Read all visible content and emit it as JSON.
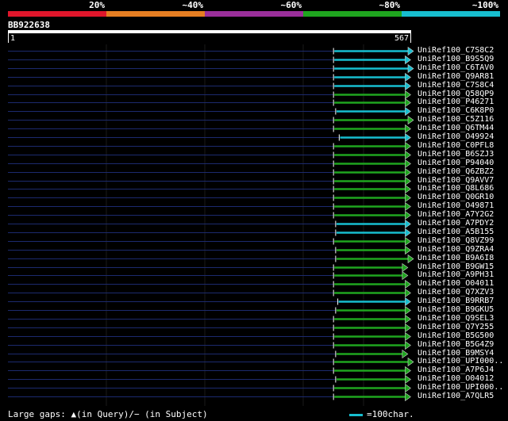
{
  "legend": {
    "items": [
      {
        "label": "20%",
        "color": "#e0162b"
      },
      {
        "label": "~40%",
        "color": "#e67e22"
      },
      {
        "label": "~60%",
        "color": "#9b2f9b"
      },
      {
        "label": "~80%",
        "color": "#1fa51f"
      },
      {
        "label": "~100%",
        "color": "#17becf"
      }
    ]
  },
  "query": {
    "name": "BB922638",
    "start": "1",
    "end": "567",
    "length": 567
  },
  "hits": [
    {
      "id": "UniRef100_C7S8C2",
      "color": "#17becf",
      "qstart": 458,
      "qend": 567,
      "arrow": true
    },
    {
      "id": "UniRef100_B9S5Q9",
      "color": "#17becf",
      "qstart": 458,
      "qend": 563,
      "arrow": true
    },
    {
      "id": "UniRef100_C6TAV0",
      "color": "#17becf",
      "qstart": 458,
      "qend": 567,
      "arrow": true
    },
    {
      "id": "UniRef100_Q9AR81",
      "color": "#17becf",
      "qstart": 458,
      "qend": 563,
      "arrow": true
    },
    {
      "id": "UniRef100_C7S8C4",
      "color": "#17becf",
      "qstart": 458,
      "qend": 563,
      "arrow": true
    },
    {
      "id": "UniRef100_Q58QP9",
      "color": "#1fa51f",
      "qstart": 458,
      "qend": 563,
      "arrow": true
    },
    {
      "id": "UniRef100_P46271",
      "color": "#1fa51f",
      "qstart": 458,
      "qend": 563,
      "arrow": true
    },
    {
      "id": "UniRef100_C6K8P0",
      "color": "#17becf",
      "qstart": 461,
      "qend": 563,
      "arrow": true
    },
    {
      "id": "UniRef100_C5Z116",
      "color": "#1fa51f",
      "qstart": 458,
      "qend": 567,
      "arrow": true
    },
    {
      "id": "UniRef100_Q6TM44",
      "color": "#1fa51f",
      "qstart": 458,
      "qend": 563,
      "arrow": true
    },
    {
      "id": "UniRef100_O49924",
      "color": "#17becf",
      "qstart": 466,
      "qend": 563,
      "arrow": true
    },
    {
      "id": "UniRef100_C0PFL8",
      "color": "#1fa51f",
      "qstart": 458,
      "qend": 563,
      "arrow": true
    },
    {
      "id": "UniRef100_B6SZJ3",
      "color": "#1fa51f",
      "qstart": 458,
      "qend": 563,
      "arrow": true
    },
    {
      "id": "UniRef100_P94040",
      "color": "#1fa51f",
      "qstart": 458,
      "qend": 563,
      "arrow": true
    },
    {
      "id": "UniRef100_Q6ZBZ2",
      "color": "#1fa51f",
      "qstart": 458,
      "qend": 563,
      "arrow": true
    },
    {
      "id": "UniRef100_Q9AVV7",
      "color": "#1fa51f",
      "qstart": 458,
      "qend": 563,
      "arrow": true
    },
    {
      "id": "UniRef100_Q8L686",
      "color": "#1fa51f",
      "qstart": 458,
      "qend": 563,
      "arrow": true
    },
    {
      "id": "UniRef100_Q0GR10",
      "color": "#1fa51f",
      "qstart": 458,
      "qend": 563,
      "arrow": true
    },
    {
      "id": "UniRef100_O49871",
      "color": "#1fa51f",
      "qstart": 458,
      "qend": 563,
      "arrow": true
    },
    {
      "id": "UniRef100_A7Y2G2",
      "color": "#1fa51f",
      "qstart": 458,
      "qend": 563,
      "arrow": true
    },
    {
      "id": "UniRef100_A7PDY2",
      "color": "#17becf",
      "qstart": 461,
      "qend": 563,
      "arrow": true
    },
    {
      "id": "UniRef100_A5B155",
      "color": "#17becf",
      "qstart": 461,
      "qend": 563,
      "arrow": true
    },
    {
      "id": "UniRef100_Q8VZ99",
      "color": "#1fa51f",
      "qstart": 458,
      "qend": 563,
      "arrow": true
    },
    {
      "id": "UniRef100_Q9ZRA4",
      "color": "#1fa51f",
      "qstart": 461,
      "qend": 563,
      "arrow": true
    },
    {
      "id": "UniRef100_B9A6I8",
      "color": "#1fa51f",
      "qstart": 461,
      "qend": 567,
      "arrow": true
    },
    {
      "id": "UniRef100_B9GW15",
      "color": "#1fa51f",
      "qstart": 458,
      "qend": 559,
      "arrow": true
    },
    {
      "id": "UniRef100_A9PH31",
      "color": "#1fa51f",
      "qstart": 458,
      "qend": 559,
      "arrow": true
    },
    {
      "id": "UniRef100_O04011",
      "color": "#1fa51f",
      "qstart": 458,
      "qend": 563,
      "arrow": true
    },
    {
      "id": "UniRef100_Q7XZV3",
      "color": "#1fa51f",
      "qstart": 458,
      "qend": 563,
      "arrow": true
    },
    {
      "id": "UniRef100_B9RRB7",
      "color": "#17becf",
      "qstart": 464,
      "qend": 563,
      "arrow": true
    },
    {
      "id": "UniRef100_B9GKU5",
      "color": "#1fa51f",
      "qstart": 461,
      "qend": 563,
      "arrow": true
    },
    {
      "id": "UniRef100_Q9SEL3",
      "color": "#1fa51f",
      "qstart": 458,
      "qend": 563,
      "arrow": true
    },
    {
      "id": "UniRef100_Q7Y255",
      "color": "#1fa51f",
      "qstart": 458,
      "qend": 563,
      "arrow": true
    },
    {
      "id": "UniRef100_B5G500",
      "color": "#1fa51f",
      "qstart": 458,
      "qend": 563,
      "arrow": true
    },
    {
      "id": "UniRef100_B5G4Z9",
      "color": "#1fa51f",
      "qstart": 458,
      "qend": 563,
      "arrow": true
    },
    {
      "id": "UniRef100_B9MSY4",
      "color": "#1fa51f",
      "qstart": 461,
      "qend": 559,
      "arrow": true
    },
    {
      "id": "UniRef100_UPI000..",
      "color": "#1fa51f",
      "qstart": 458,
      "qend": 567,
      "arrow": true
    },
    {
      "id": "UniRef100_A7P6J4",
      "color": "#1fa51f",
      "qstart": 458,
      "qend": 563,
      "arrow": true
    },
    {
      "id": "UniRef100_O04012",
      "color": "#1fa51f",
      "qstart": 461,
      "qend": 563,
      "arrow": true
    },
    {
      "id": "UniRef100_UPI000..",
      "color": "#1fa51f",
      "qstart": 458,
      "qend": 563,
      "arrow": true
    },
    {
      "id": "UniRef100_A7QLR5",
      "color": "#1fa51f",
      "qstart": 458,
      "qend": 563,
      "arrow": true
    }
  ],
  "footer": {
    "gaps_text": "Large gaps: ▲(in Query)/− (in Subject)",
    "scale_label": "=100char.",
    "scale_color": "#17becf"
  }
}
